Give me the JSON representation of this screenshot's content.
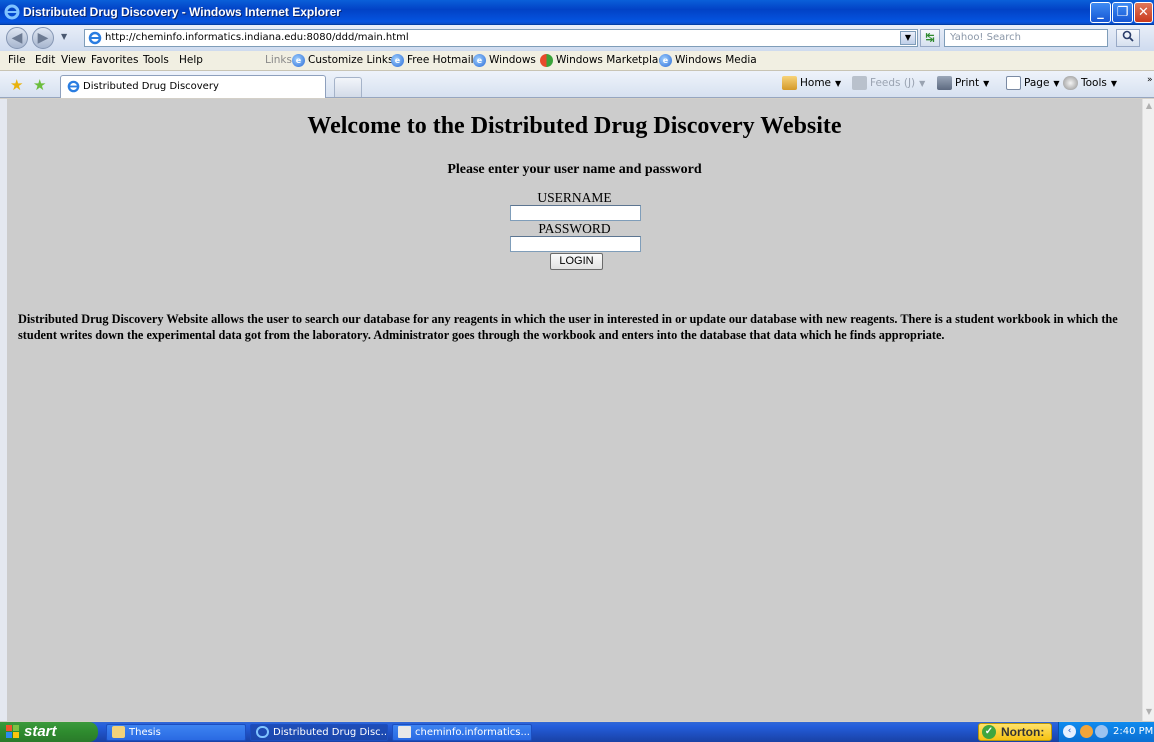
{
  "window": {
    "title": "Distributed Drug Discovery - Windows Internet Explorer"
  },
  "address": {
    "url": "http://cheminfo.informatics.indiana.edu:8080/ddd/main.html",
    "search_placeholder": "Yahoo! Search"
  },
  "menu": [
    "File",
    "Edit",
    "View",
    "Favorites",
    "Tools",
    "Help"
  ],
  "links": {
    "label": "Links",
    "items": [
      "Customize Links",
      "Free Hotmail",
      "Windows",
      "Windows Marketplace",
      "Windows Media"
    ]
  },
  "tab": {
    "label": "Distributed Drug Discovery"
  },
  "commands": {
    "home": "Home",
    "feeds": "Feeds (J)",
    "print": "Print",
    "page": "Page",
    "tools": "Tools"
  },
  "page": {
    "heading": "Welcome to the Distributed Drug Discovery Website",
    "prompt": "Please enter your user name and password",
    "username_label": "USERNAME",
    "password_label": "PASSWORD",
    "login_button": "LOGIN",
    "description": "Distributed Drug Discovery Website allows the user to search our database for any reagents in which the user in interested in or update our database with new reagents. There is a student workbook in which the student writes down the experimental data got from the laboratory. Administrator goes through the workbook and enters into the database that data which he finds appropriate."
  },
  "taskbar": {
    "start": "start",
    "tasks": [
      "Thesis",
      "Distributed Drug Disc...",
      "cheminfo.informatics...."
    ],
    "norton": "Norton",
    "clock": "2:40 PM"
  }
}
